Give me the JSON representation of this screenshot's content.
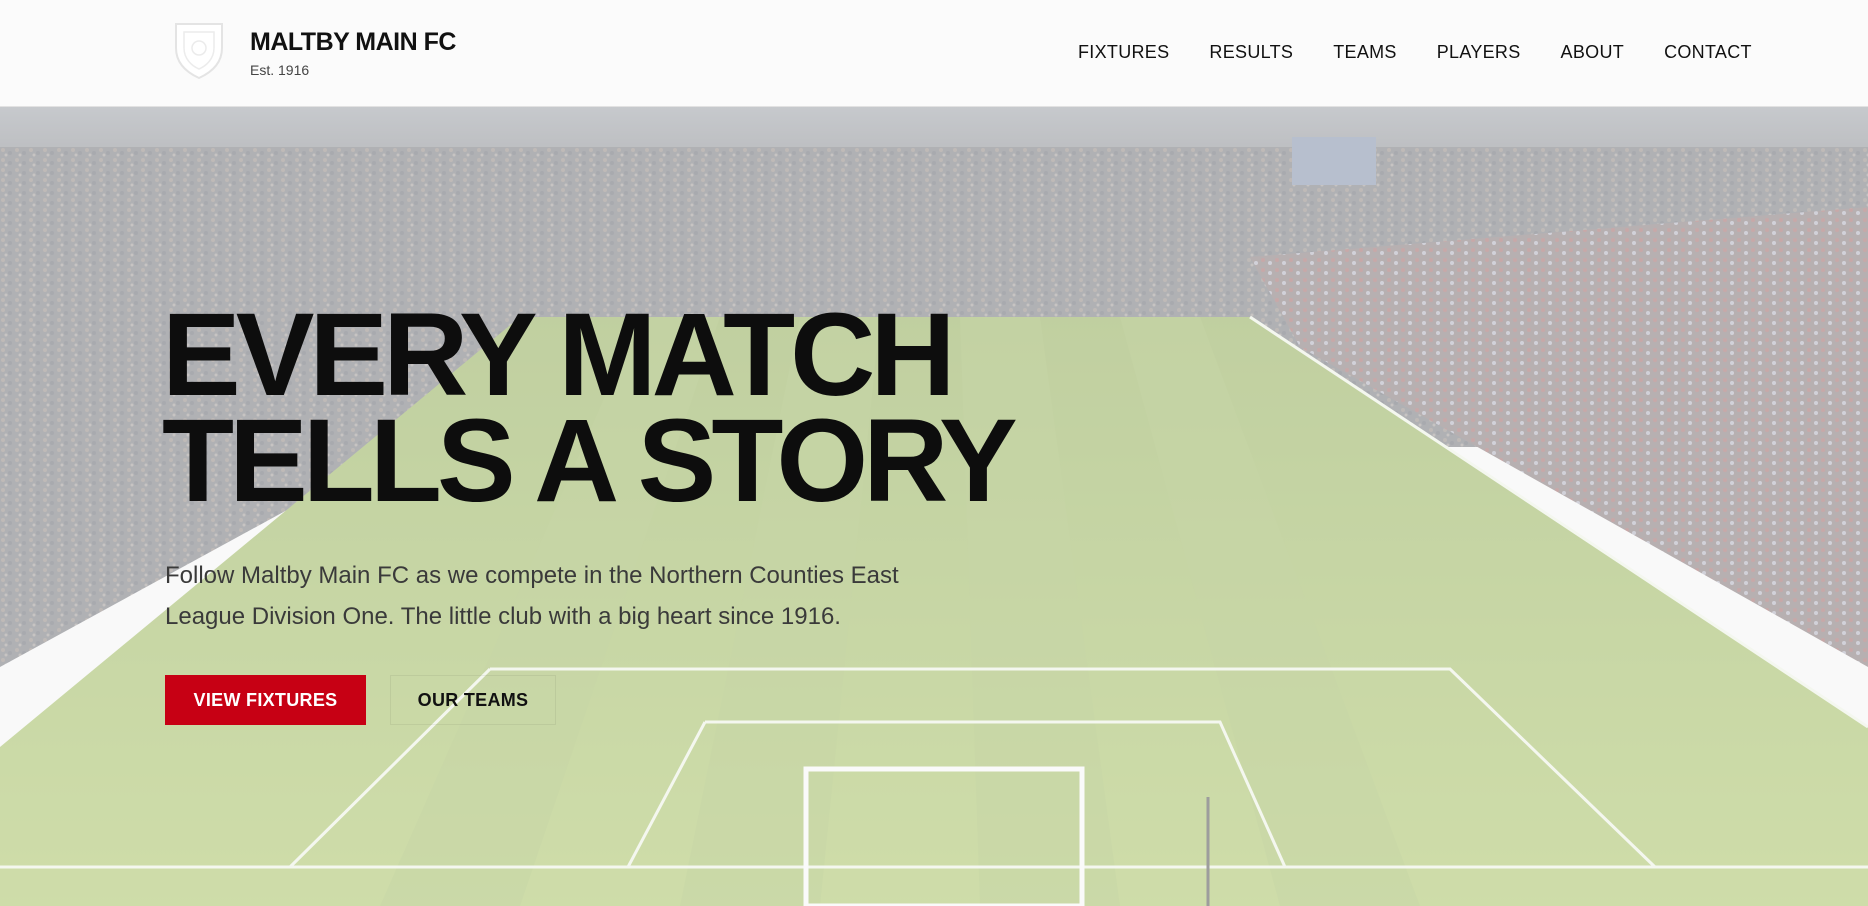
{
  "brand": {
    "name": "MALTBY MAIN FC",
    "established": "Est. 1916"
  },
  "nav": {
    "items": [
      "FIXTURES",
      "RESULTS",
      "TEAMS",
      "PLAYERS",
      "ABOUT",
      "CONTACT"
    ]
  },
  "hero": {
    "headline_line1": "EVERY MATCH",
    "headline_line2": "TELLS A STORY",
    "subtext": "Follow Maltby Main FC as we compete in the Northern Counties East League Division One. The little club with a big heart since 1916.",
    "primary_button": "VIEW FIXTURES",
    "secondary_button": "OUR TEAMS",
    "background": "stadium-photo"
  },
  "colors": {
    "accent": "#c70014",
    "text": "#0d0d0d",
    "header_bg": "#fbfbfb"
  }
}
